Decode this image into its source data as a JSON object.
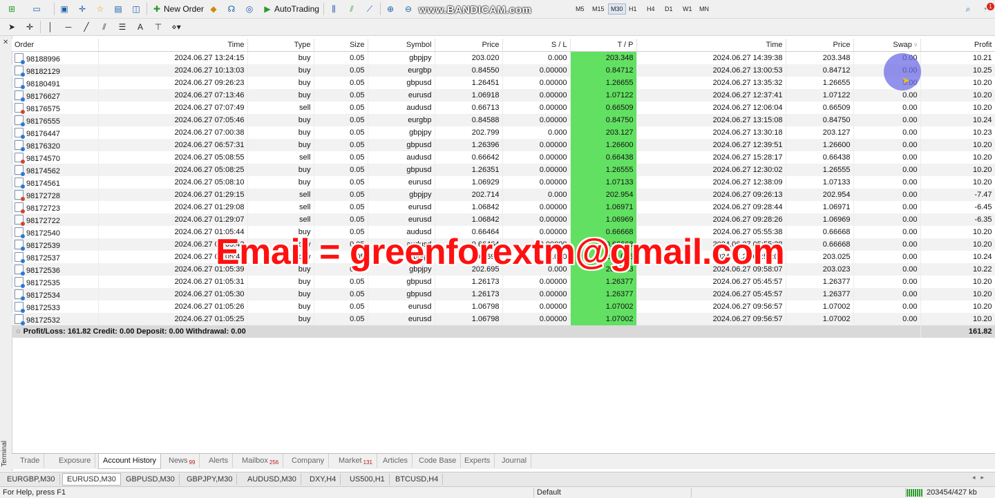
{
  "toolbar": {
    "new_order_label": "New Order",
    "autotrading_label": "AutoTrading",
    "timeframes": [
      "M5",
      "M15",
      "M30",
      "H1",
      "H4",
      "D1",
      "W1",
      "MN"
    ],
    "active_timeframe": "M30",
    "notification_count": "1",
    "watermark": "www.BANDICAM.com"
  },
  "sidebar": {
    "label": "Terminal"
  },
  "columns": {
    "order": "Order",
    "time": "Time",
    "type": "Type",
    "size": "Size",
    "symbol": "Symbol",
    "price": "Price",
    "sl": "S / L",
    "tp": "T / P",
    "close_time": "Time",
    "close_price": "Price",
    "swap": "Swap",
    "profit": "Profit"
  },
  "rows": [
    {
      "order": "98188996",
      "time": "2024.06.27 13:24:15",
      "type": "buy",
      "size": "0.05",
      "symbol": "gbpjpy",
      "price": "203.020",
      "sl": "0.000",
      "tp": "203.348",
      "close_time": "2024.06.27 14:39:38",
      "close_price": "203.348",
      "swap": "0.00",
      "profit": "10.21"
    },
    {
      "order": "98182129",
      "time": "2024.06.27 10:13:03",
      "type": "buy",
      "size": "0.05",
      "symbol": "eurgbp",
      "price": "0.84550",
      "sl": "0.00000",
      "tp": "0.84712",
      "close_time": "2024.06.27 13:00:53",
      "close_price": "0.84712",
      "swap": "0.00",
      "profit": "10.25"
    },
    {
      "order": "98180491",
      "time": "2024.06.27 09:26:23",
      "type": "buy",
      "size": "0.05",
      "symbol": "gbpusd",
      "price": "1.26451",
      "sl": "0.00000",
      "tp": "1.26655",
      "close_time": "2024.06.27 13:35:32",
      "close_price": "1.26655",
      "swap": "0.00",
      "profit": "10.20"
    },
    {
      "order": "98176627",
      "time": "2024.06.27 07:13:46",
      "type": "buy",
      "size": "0.05",
      "symbol": "eurusd",
      "price": "1.06918",
      "sl": "0.00000",
      "tp": "1.07122",
      "close_time": "2024.06.27 12:37:41",
      "close_price": "1.07122",
      "swap": "0.00",
      "profit": "10.20"
    },
    {
      "order": "98176575",
      "time": "2024.06.27 07:07:49",
      "type": "sell",
      "size": "0.05",
      "symbol": "audusd",
      "price": "0.66713",
      "sl": "0.00000",
      "tp": "0.66509",
      "close_time": "2024.06.27 12:06:04",
      "close_price": "0.66509",
      "swap": "0.00",
      "profit": "10.20"
    },
    {
      "order": "98176555",
      "time": "2024.06.27 07:05:46",
      "type": "buy",
      "size": "0.05",
      "symbol": "eurgbp",
      "price": "0.84588",
      "sl": "0.00000",
      "tp": "0.84750",
      "close_time": "2024.06.27 13:15:08",
      "close_price": "0.84750",
      "swap": "0.00",
      "profit": "10.24"
    },
    {
      "order": "98176447",
      "time": "2024.06.27 07:00:38",
      "type": "buy",
      "size": "0.05",
      "symbol": "gbpjpy",
      "price": "202.799",
      "sl": "0.000",
      "tp": "203.127",
      "close_time": "2024.06.27 13:30:18",
      "close_price": "203.127",
      "swap": "0.00",
      "profit": "10.23"
    },
    {
      "order": "98176320",
      "time": "2024.06.27 06:57:31",
      "type": "buy",
      "size": "0.05",
      "symbol": "gbpusd",
      "price": "1.26396",
      "sl": "0.00000",
      "tp": "1.26600",
      "close_time": "2024.06.27 12:39:51",
      "close_price": "1.26600",
      "swap": "0.00",
      "profit": "10.20"
    },
    {
      "order": "98174570",
      "time": "2024.06.27 05:08:55",
      "type": "sell",
      "size": "0.05",
      "symbol": "audusd",
      "price": "0.66642",
      "sl": "0.00000",
      "tp": "0.66438",
      "close_time": "2024.06.27 15:28:17",
      "close_price": "0.66438",
      "swap": "0.00",
      "profit": "10.20"
    },
    {
      "order": "98174562",
      "time": "2024.06.27 05:08:25",
      "type": "buy",
      "size": "0.05",
      "symbol": "gbpusd",
      "price": "1.26351",
      "sl": "0.00000",
      "tp": "1.26555",
      "close_time": "2024.06.27 12:30:02",
      "close_price": "1.26555",
      "swap": "0.00",
      "profit": "10.20"
    },
    {
      "order": "98174561",
      "time": "2024.06.27 05:08:10",
      "type": "buy",
      "size": "0.05",
      "symbol": "eurusd",
      "price": "1.06929",
      "sl": "0.00000",
      "tp": "1.07133",
      "close_time": "2024.06.27 12:38:09",
      "close_price": "1.07133",
      "swap": "0.00",
      "profit": "10.20"
    },
    {
      "order": "98172728",
      "time": "2024.06.27 01:29:15",
      "type": "sell",
      "size": "0.05",
      "symbol": "gbpjpy",
      "price": "202.714",
      "sl": "0.000",
      "tp": "202.954",
      "close_time": "2024.06.27 09:26:13",
      "close_price": "202.954",
      "swap": "0.00",
      "profit": "-7.47"
    },
    {
      "order": "98172723",
      "time": "2024.06.27 01:29:08",
      "type": "sell",
      "size": "0.05",
      "symbol": "eurusd",
      "price": "1.06842",
      "sl": "0.00000",
      "tp": "1.06971",
      "close_time": "2024.06.27 09:28:44",
      "close_price": "1.06971",
      "swap": "0.00",
      "profit": "-6.45"
    },
    {
      "order": "98172722",
      "time": "2024.06.27 01:29:07",
      "type": "sell",
      "size": "0.05",
      "symbol": "eurusd",
      "price": "1.06842",
      "sl": "0.00000",
      "tp": "1.06969",
      "close_time": "2024.06.27 09:28:26",
      "close_price": "1.06969",
      "swap": "0.00",
      "profit": "-6.35"
    },
    {
      "order": "98172540",
      "time": "2024.06.27 01:05:44",
      "type": "buy",
      "size": "0.05",
      "symbol": "audusd",
      "price": "0.66464",
      "sl": "0.00000",
      "tp": "0.66668",
      "close_time": "2024.06.27 05:55:38",
      "close_price": "0.66668",
      "swap": "0.00",
      "profit": "10.20"
    },
    {
      "order": "98172539",
      "time": "2024.06.27 01:05:43",
      "type": "buy",
      "size": "0.05",
      "symbol": "audusd",
      "price": "0.66464",
      "sl": "0.00000",
      "tp": "0.66668",
      "close_time": "2024.06.27 05:55:38",
      "close_price": "0.66668",
      "swap": "0.00",
      "profit": "10.20"
    },
    {
      "order": "98172537",
      "time": "2024.06.27 01:05:40",
      "type": "buy",
      "size": "0.05",
      "symbol": "gbpjpy",
      "price": "202.690",
      "sl": "0.000",
      "tp": "203.025",
      "close_time": "2024.06.27 09:58:07",
      "close_price": "203.025",
      "swap": "0.00",
      "profit": "10.24"
    },
    {
      "order": "98172536",
      "time": "2024.06.27 01:05:39",
      "type": "buy",
      "size": "0.05",
      "symbol": "gbpjpy",
      "price": "202.695",
      "sl": "0.000",
      "tp": "203.023",
      "close_time": "2024.06.27 09:58:07",
      "close_price": "203.023",
      "swap": "0.00",
      "profit": "10.22"
    },
    {
      "order": "98172535",
      "time": "2024.06.27 01:05:31",
      "type": "buy",
      "size": "0.05",
      "symbol": "gbpusd",
      "price": "1.26173",
      "sl": "0.00000",
      "tp": "1.26377",
      "close_time": "2024.06.27 05:45:57",
      "close_price": "1.26377",
      "swap": "0.00",
      "profit": "10.20"
    },
    {
      "order": "98172534",
      "time": "2024.06.27 01:05:30",
      "type": "buy",
      "size": "0.05",
      "symbol": "gbpusd",
      "price": "1.26173",
      "sl": "0.00000",
      "tp": "1.26377",
      "close_time": "2024.06.27 05:45:57",
      "close_price": "1.26377",
      "swap": "0.00",
      "profit": "10.20"
    },
    {
      "order": "98172533",
      "time": "2024.06.27 01:05:26",
      "type": "buy",
      "size": "0.05",
      "symbol": "eurusd",
      "price": "1.06798",
      "sl": "0.00000",
      "tp": "1.07002",
      "close_time": "2024.06.27 09:56:57",
      "close_price": "1.07002",
      "swap": "0.00",
      "profit": "10.20"
    },
    {
      "order": "98172532",
      "time": "2024.06.27 01:05:25",
      "type": "buy",
      "size": "0.05",
      "symbol": "eurusd",
      "price": "1.06798",
      "sl": "0.00000",
      "tp": "1.07002",
      "close_time": "2024.06.27 09:56:57",
      "close_price": "1.07002",
      "swap": "0.00",
      "profit": "10.20"
    }
  ],
  "summary": {
    "text": "Profit/Loss: 161.82  Credit: 0.00  Deposit: 0.00  Withdrawal: 0.00",
    "total": "161.82"
  },
  "overlay": {
    "email": "Email = greenforextm@gmail.com"
  },
  "terminal_tabs": [
    {
      "label": "Trade"
    },
    {
      "label": "Exposure"
    },
    {
      "label": "Account History",
      "active": true
    },
    {
      "label": "News",
      "badge": "99"
    },
    {
      "label": "Alerts"
    },
    {
      "label": "Mailbox",
      "badge": "256"
    },
    {
      "label": "Company"
    },
    {
      "label": "Market",
      "badge": "131"
    },
    {
      "label": "Articles"
    },
    {
      "label": "Code Base"
    },
    {
      "label": "Experts"
    },
    {
      "label": "Journal"
    }
  ],
  "chart_tabs": [
    {
      "label": "EURGBP,M30"
    },
    {
      "label": "EURUSD,M30",
      "active": true
    },
    {
      "label": "GBPUSD,M30"
    },
    {
      "label": "GBPJPY,M30"
    },
    {
      "label": "AUDUSD,M30"
    },
    {
      "label": "DXY,H4"
    },
    {
      "label": "US500,H1"
    },
    {
      "label": "BTCUSD,H4"
    }
  ],
  "status": {
    "help": "For Help, press F1",
    "profile": "Default",
    "traffic": "203454/427 kb"
  },
  "colors": {
    "tp_highlight": "#62e062",
    "summary_bg": "#d9d9d9",
    "overlay_text": "#ff1010"
  }
}
